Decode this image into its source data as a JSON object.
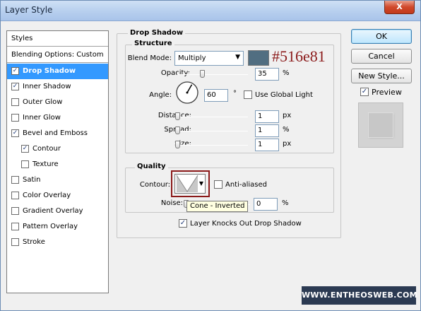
{
  "window": {
    "title": "Layer Style",
    "close_label": "X"
  },
  "styles_list": {
    "header": "Styles",
    "blending_options": "Blending Options: Custom",
    "items": [
      {
        "label": "Drop Shadow",
        "checked": true,
        "mark": "✓",
        "selected": true
      },
      {
        "label": "Inner Shadow",
        "checked": true,
        "mark": "✓"
      },
      {
        "label": "Outer Glow",
        "checked": false,
        "mark": ""
      },
      {
        "label": "Inner Glow",
        "checked": false,
        "mark": ""
      },
      {
        "label": "Bevel and Emboss",
        "checked": true,
        "mark": "✓"
      },
      {
        "label": "Contour",
        "checked": true,
        "mark": "✓",
        "indent": true
      },
      {
        "label": "Texture",
        "checked": false,
        "mark": "",
        "indent": true
      },
      {
        "label": "Satin",
        "checked": false,
        "mark": ""
      },
      {
        "label": "Color Overlay",
        "checked": false,
        "mark": ""
      },
      {
        "label": "Gradient Overlay",
        "checked": false,
        "mark": ""
      },
      {
        "label": "Pattern Overlay",
        "checked": false,
        "mark": ""
      },
      {
        "label": "Stroke",
        "checked": false,
        "mark": ""
      }
    ]
  },
  "drop_shadow": {
    "section_title": "Drop Shadow",
    "structure": {
      "title": "Structure",
      "blend_mode_label": "Blend Mode:",
      "blend_mode_value": "Multiply",
      "swatch_color": "#516e81",
      "color_annotation": "#516e81",
      "opacity_label": "Opacity:",
      "opacity_value": "35",
      "opacity_unit": "%",
      "opacity_fraction": 0.35,
      "angle_label": "Angle:",
      "angle_value": "60",
      "angle_unit": "°",
      "use_global_light_label": "Use Global Light",
      "use_global_light_checked": false,
      "distance_label": "Distance:",
      "distance_value": "1",
      "distance_unit": "px",
      "spread_label": "Spread:",
      "spread_value": "1",
      "spread_unit": "%",
      "size_label": "Size:",
      "size_value": "1",
      "size_unit": "px"
    },
    "quality": {
      "title": "Quality",
      "contour_label": "Contour:",
      "anti_aliased_label": "Anti-aliased",
      "anti_aliased_checked": false,
      "noise_label": "Noise:",
      "noise_value": "0",
      "noise_unit": "%",
      "tooltip": "Cone - Inverted",
      "highlight_color": "#8b1a1a"
    },
    "knocks_out_label": "Layer Knocks Out Drop Shadow",
    "knocks_out_checked": true,
    "knocks_out_mark": "✓"
  },
  "buttons": {
    "ok": "OK",
    "cancel": "Cancel",
    "new_style": "New Style..."
  },
  "preview": {
    "label": "Preview",
    "checked": true,
    "mark": "✓"
  },
  "watermark": "WWW.ENTHEOSWEB.COM",
  "annotation_color": "#8b1a1a"
}
